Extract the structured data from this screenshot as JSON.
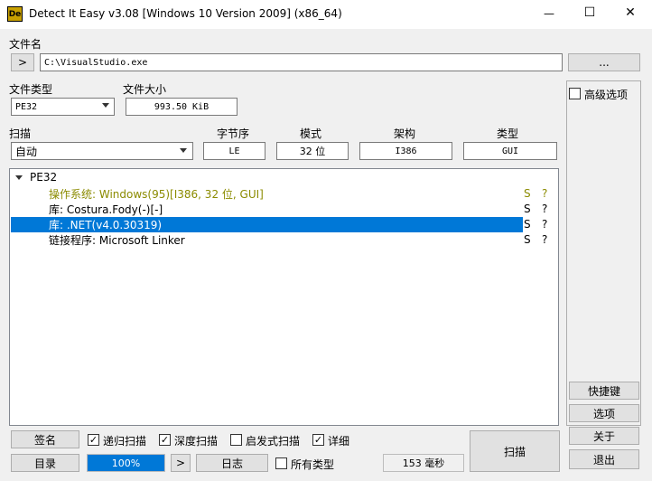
{
  "titlebar": {
    "title": "Detect It Easy v3.08 [Windows 10 Version 2009] (x86_64)",
    "app_icon_text": "De",
    "minimize": "—",
    "maximize": "☐",
    "close": "✕"
  },
  "file": {
    "label": "文件名",
    "nav_button": ">",
    "path": "C:\\VisualStudio.exe",
    "browse_button": "..."
  },
  "filetype": {
    "label": "文件类型",
    "value": "PE32"
  },
  "filesize": {
    "label": "文件大小",
    "value": "993.50 KiB"
  },
  "advanced": {
    "label": "高级选项",
    "checked": false
  },
  "scan": {
    "label": "扫描",
    "value": "自动"
  },
  "props": {
    "endian_label": "字节序",
    "endian_value": "LE",
    "mode_label": "模式",
    "mode_value": "32 位",
    "arch_label": "架构",
    "arch_value": "I386",
    "type_label": "类型",
    "type_value": "GUI"
  },
  "results": {
    "root": "PE32",
    "rows": [
      {
        "text": "操作系统: Windows(95)[I386, 32 位, GUI]",
        "s": "S",
        "q": "?",
        "color": "#8b8b00",
        "selected": false
      },
      {
        "text": "库: Costura.Fody(-)[-]",
        "s": "S",
        "q": "?",
        "color": "#000000",
        "selected": false
      },
      {
        "text": "库: .NET(v4.0.30319)",
        "s": "S",
        "q": "?",
        "color": "#ffffff",
        "selected": true
      },
      {
        "text": "链接程序: Microsoft Linker",
        "s": "S",
        "q": "?",
        "color": "#000000",
        "selected": false
      }
    ]
  },
  "side": {
    "shortcuts": "快捷键",
    "options": "选项",
    "about": "关于",
    "exit": "退出"
  },
  "bottom": {
    "signature": "签名",
    "recursive": "递归扫描",
    "deep": "深度扫描",
    "heuristic": "启发式扫描",
    "verbose": "详细",
    "directory": "目录",
    "progress_text": "100%",
    "progress": 1.0,
    "next": ">",
    "log": "日志",
    "alltypes": "所有类型",
    "time": "153 毫秒",
    "scan_button": "扫描"
  },
  "checkbox_states": {
    "recursive": true,
    "deep": true,
    "heuristic": false,
    "verbose": true,
    "alltypes": false
  },
  "check_mark": "✓",
  "colors": {
    "selection": "#0078d7",
    "progress": "#0078d7"
  }
}
